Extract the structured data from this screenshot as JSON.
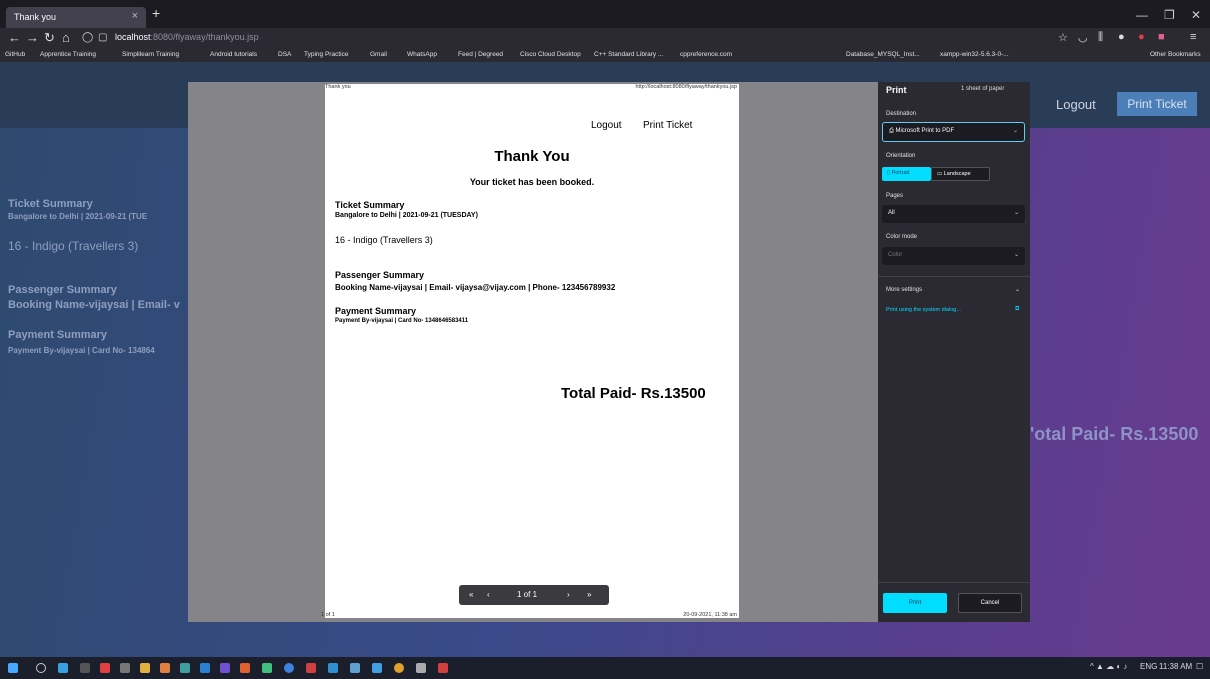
{
  "browser": {
    "tab_title": "Thank you",
    "tab_close": "×",
    "new_tab": "+",
    "url_host": "localhost",
    "url_rest": ":8080/flyaway/thankyou.jsp",
    "bookmarks": [
      "GitHub",
      "Apprentice Training",
      "Simplilearn Training",
      "Android tutorials",
      "DSA",
      "Typing Practice",
      "Gmail",
      "WhatsApp",
      "Feed | Degreed",
      "Cisco Cloud Desktop",
      "C++ Standard Library ...",
      "cppreference.com",
      "Database_MYSQL_Inst...",
      "xampp-win32-5.6.3-0-..."
    ],
    "other_bookmarks": "Other Bookmarks"
  },
  "site": {
    "logout": "Logout",
    "print_ticket": "Print Ticket",
    "ticket_summary_heading": "Ticket Summary",
    "route_partial": "Bangalore to Delhi | 2021-09-21 (TUE",
    "flight_line": "16 - Indigo (Travellers 3)",
    "passenger_heading": "Passenger Summary",
    "booking_partial": "Booking Name-vijaysai | Email- v",
    "payment_heading": "Payment Summary",
    "payment_partial": "Payment By-vijaysai | Card No- 134864",
    "total_partial": "'otal Paid- Rs.13500"
  },
  "preview": {
    "header_left": "Thank you",
    "header_right": "http://localhost:8080/flyaway/thankyou.jsp",
    "logout": "Logout",
    "print_ticket": "Print Ticket",
    "title": "Thank You",
    "subtitle": "Your ticket has been booked.",
    "ticket_summary_heading": "Ticket Summary",
    "route": "Bangalore to Delhi | 2021-09-21 (TUESDAY)",
    "flight_line": "16 - Indigo (Travellers 3)",
    "passenger_heading": "Passenger Summary",
    "booking_line": "Booking Name-vijaysai | Email- vijaysa@vijay.com | Phone- 123456789932",
    "payment_heading": "Payment Summary",
    "payment_line": "Payment By-vijaysai | Card No- 1348646583411",
    "total": "Total Paid- Rs.13500",
    "footer_left": "1 of 1",
    "footer_right": "20-09-2021, 11:38 am",
    "pager_label": "1 of 1"
  },
  "print_panel": {
    "title": "Print",
    "sheets": "1 sheet of paper",
    "destination_label": "Destination",
    "destination_value": "Microsoft Print to PDF",
    "orientation_label": "Orientation",
    "portrait": "Portrait",
    "landscape": "Landscape",
    "pages_label": "Pages",
    "pages_value": "All",
    "color_mode_label": "Color mode",
    "color_mode_value": "Color",
    "more_settings": "More settings",
    "system_dialog": "Print using the system dialog...",
    "print_button": "Print",
    "cancel_button": "Cancel"
  },
  "taskbar": {
    "language": "ENG",
    "time": "11:38 AM"
  }
}
